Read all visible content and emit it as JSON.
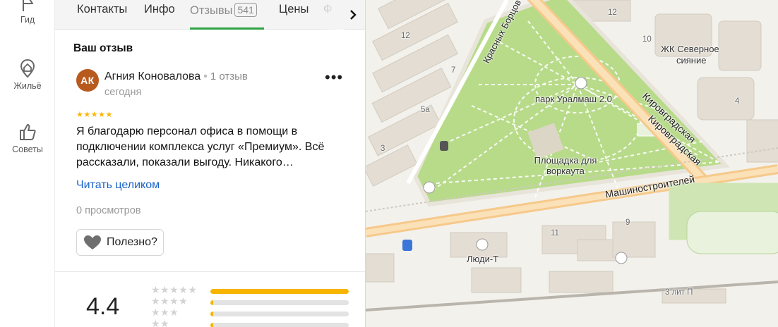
{
  "rail": {
    "items": [
      {
        "label": "Гид",
        "icon": "flag-icon"
      },
      {
        "label": "Жильё",
        "icon": "house-pin-icon"
      },
      {
        "label": "Советы",
        "icon": "thumbs-up-icon"
      }
    ]
  },
  "tabs": {
    "contacts": "Контакты",
    "info": "Инфо",
    "reviews": "Отзывы",
    "reviews_count": "541",
    "prices": "Цены",
    "partial": "Ф"
  },
  "review": {
    "section_title": "Ваш отзыв",
    "avatar_initials": "АК",
    "author": "Агния Коновалова",
    "author_reviews": "1 отзыв",
    "date": "сегодня",
    "stars": "★★★★★",
    "text": "Я благодарю персонал офиса в помощи в подключении комплекса услуг «Премиум». Всё рассказали, показали выгоду. Никакого…",
    "read_more": "Читать целиком",
    "views": "0 просмотров",
    "useful_label": "Полезно?"
  },
  "rating": {
    "value": "4.4",
    "distribution": [
      {
        "stars": "★★★★★",
        "fraction": 1.0
      },
      {
        "stars": "★★★★",
        "fraction": 0.02
      },
      {
        "stars": "★★★",
        "fraction": 0.02
      },
      {
        "stars": "★★",
        "fraction": 0.02
      }
    ]
  },
  "map": {
    "labels": {
      "park": "парк Уралмаш 2.0",
      "workout": "Площадка для\nворкаута",
      "residential_1": "ЖК Северное",
      "residential_2": "сияние",
      "street_kirov_1": "Кировградская",
      "street_kirov_2": "Кировградская",
      "street_mash": "Машиностроителей",
      "street_bortsov": "Красных Борцов",
      "people": "Люди-Т",
      "lit_p": "3 лит П"
    },
    "numbers": {
      "n12a": "12",
      "n12b": "12",
      "n10": "10",
      "n7": "7",
      "n5a": "5а",
      "n3": "3",
      "n4": "4",
      "n11": "11",
      "n9": "9"
    },
    "colors": {
      "park": "#b8db8a",
      "road": "#f6c98a",
      "building": "#e3ddd3"
    }
  }
}
